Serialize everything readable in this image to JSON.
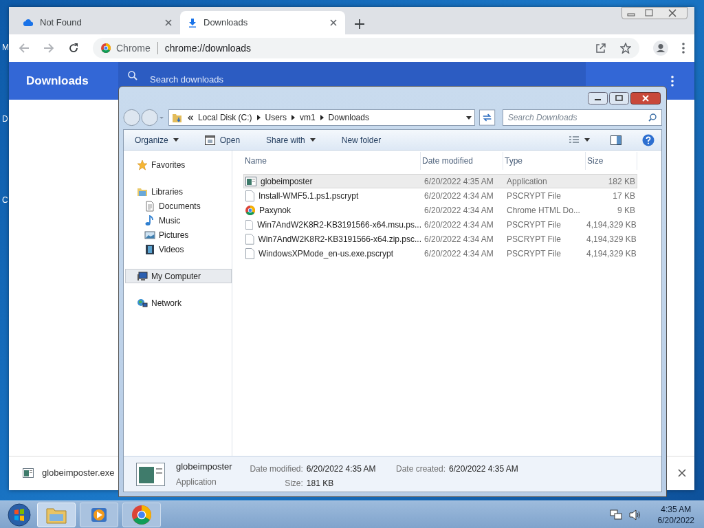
{
  "desktop": {
    "icon_labels": [
      "M",
      "D",
      "C"
    ]
  },
  "chrome": {
    "tabs": [
      {
        "title": "Not Found",
        "kind": "cloud",
        "selected": false
      },
      {
        "title": "Downloads",
        "kind": "download",
        "selected": true
      }
    ],
    "omnibox": {
      "site_label": "Chrome",
      "url": "chrome://downloads"
    },
    "page": {
      "title": "Downloads",
      "search_placeholder": "Search downloads"
    },
    "shelf": {
      "filename": "globeimposter.exe"
    }
  },
  "explorer": {
    "breadcrumb": [
      "Local Disk (C:)",
      "Users",
      "vm1",
      "Downloads"
    ],
    "search_placeholder": "Search Downloads",
    "commands": [
      {
        "label": "Organize",
        "kind": "menu"
      },
      {
        "label": "Open",
        "kind": "open"
      },
      {
        "label": "Share with",
        "kind": "menu"
      },
      {
        "label": "New folder",
        "kind": "plain"
      }
    ],
    "nav": [
      {
        "label": "Favorites",
        "kind": "star",
        "selected": false
      },
      {
        "label": "Libraries",
        "kind": "library",
        "selected": false,
        "children": [
          {
            "label": "Documents",
            "kind": "document"
          },
          {
            "label": "Music",
            "kind": "music"
          },
          {
            "label": "Pictures",
            "kind": "pictures"
          },
          {
            "label": "Videos",
            "kind": "video"
          }
        ]
      },
      {
        "label": "My Computer",
        "kind": "computer",
        "selected": true
      },
      {
        "label": "Network",
        "kind": "network",
        "selected": false
      }
    ],
    "columns": [
      "Name",
      "Date modified",
      "Type",
      "Size"
    ],
    "rows": [
      {
        "name": "globeimposter",
        "date": "6/20/2022 4:35 AM",
        "type": "Application",
        "size": "182 KB",
        "kind": "app",
        "selected": true
      },
      {
        "name": "Install-WMF5.1.ps1.pscrypt",
        "date": "6/20/2022 4:34 AM",
        "type": "PSCRYPT File",
        "size": "17 KB",
        "kind": "file",
        "selected": false
      },
      {
        "name": "Paxynok",
        "date": "6/20/2022 4:34 AM",
        "type": "Chrome HTML Do...",
        "size": "9 KB",
        "kind": "chrome",
        "selected": false
      },
      {
        "name": "Win7AndW2K8R2-KB3191566-x64.msu.ps...",
        "date": "6/20/2022 4:34 AM",
        "type": "PSCRYPT File",
        "size": "4,194,329 KB",
        "kind": "file",
        "selected": false
      },
      {
        "name": "Win7AndW2K8R2-KB3191566-x64.zip.psc...",
        "date": "6/20/2022 4:34 AM",
        "type": "PSCRYPT File",
        "size": "4,194,329 KB",
        "kind": "file",
        "selected": false
      },
      {
        "name": "WindowsXPMode_en-us.exe.pscrypt",
        "date": "6/20/2022 4:34 AM",
        "type": "PSCRYPT File",
        "size": "4,194,329 KB",
        "kind": "file",
        "selected": false
      }
    ],
    "details": {
      "name": "globeimposter",
      "type": "Application",
      "fields": [
        {
          "label": "Date modified:",
          "value": "6/20/2022 4:35 AM"
        },
        {
          "label": "Size:",
          "value": "181 KB"
        },
        {
          "label": "Date created:",
          "value": "6/20/2022 4:35 AM"
        }
      ]
    }
  },
  "taskbar": {
    "apps": [
      {
        "kind": "folder",
        "selected": true
      },
      {
        "kind": "media",
        "selected": false
      },
      {
        "kind": "chrome",
        "selected": false
      }
    ],
    "time": "4:35 AM",
    "date": "6/20/2022"
  }
}
